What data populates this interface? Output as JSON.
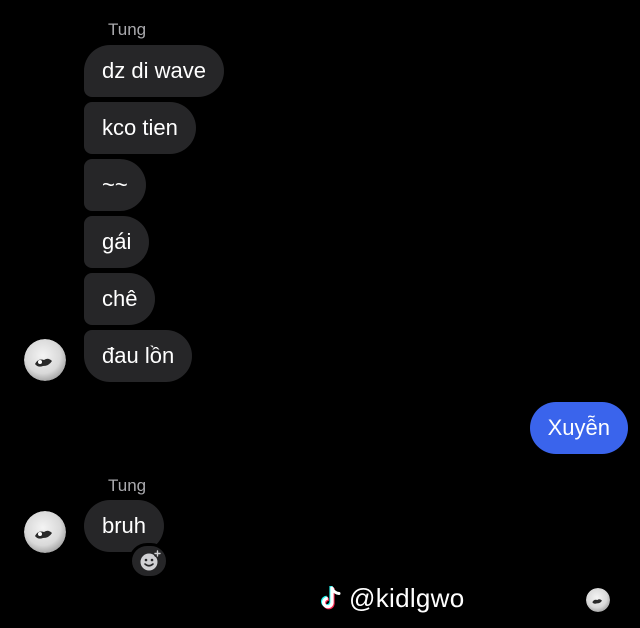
{
  "thread": {
    "group1": {
      "sender_name": "Tung",
      "messages": [
        "dz di wave",
        "kco tien",
        "~~",
        "gái",
        "chê",
        "đau lồn"
      ]
    },
    "my_message": "Xuyễn",
    "group2": {
      "sender_name": "Tung",
      "messages": [
        "bruh"
      ]
    }
  },
  "icons": {
    "avatar": "profile-avatar-icon",
    "reaction": "add-reaction-icon",
    "tiktok": "tiktok-logo-icon",
    "read_receipt": "read-receipt-avatar-icon"
  },
  "watermark": {
    "handle": "@kidlgwo"
  },
  "colors": {
    "background": "#000000",
    "incoming_bubble": "#262628",
    "outgoing_bubble": "#3a64ec",
    "sender_label": "#a9a9ad"
  }
}
